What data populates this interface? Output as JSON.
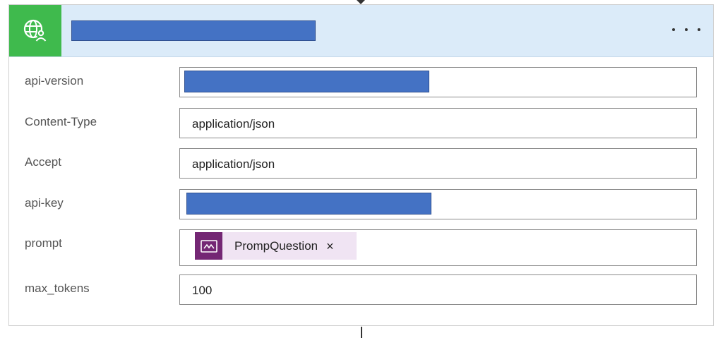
{
  "header": {
    "icon": "globe-user-icon",
    "more_icon": "more-options-icon"
  },
  "fields": [
    {
      "label": "api-version",
      "value": ""
    },
    {
      "label": "Content-Type",
      "value": "application/json"
    },
    {
      "label": "Accept",
      "value": "application/json"
    },
    {
      "label": "api-key",
      "value": ""
    },
    {
      "label": "prompt",
      "token": {
        "icon": "power-apps-icon",
        "label": "PrompQuestion",
        "close_icon": "close-icon",
        "close": "×"
      }
    },
    {
      "label": "max_tokens",
      "value": "100"
    }
  ],
  "colors": {
    "header_bg": "#dbebf9",
    "icon_bg": "#3fba4d",
    "redaction": "#4472c4",
    "token_bg": "#f0e4f3",
    "token_icon_bg": "#742774"
  }
}
